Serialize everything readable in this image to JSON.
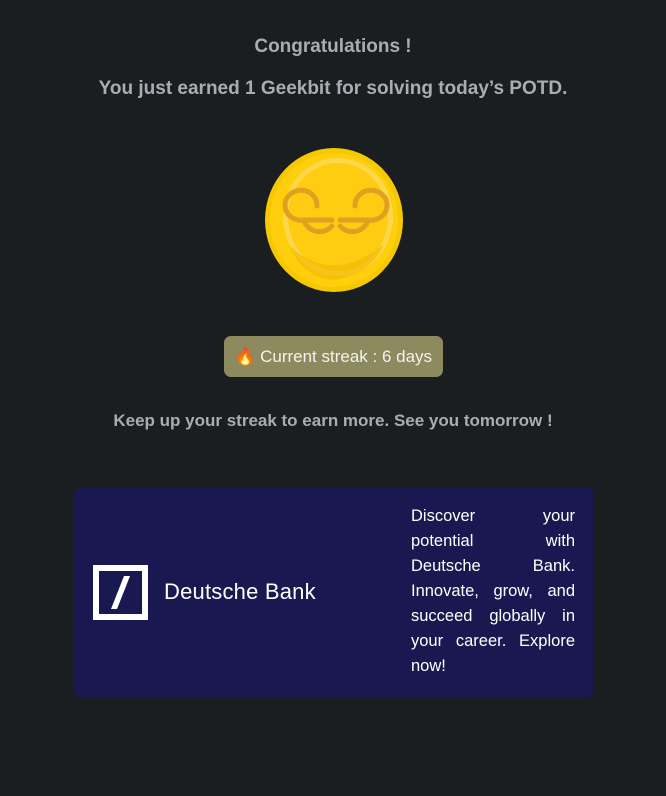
{
  "dialog": {
    "title": "Congratulations !",
    "subtitle": "You just earned 1 Geekbit for solving today’s POTD.",
    "coin": {
      "icon": "geeksforgeeks-coin-icon",
      "colors": {
        "rim": "#f5c800",
        "face": "#ffd21a",
        "emblem": "#e0a020"
      }
    },
    "streak": {
      "icon": "fire-icon",
      "label": "Current streak : 6 days",
      "days": 6,
      "badge_color": "#8d8a60"
    },
    "encouragement": "Keep up your streak to earn more. See you tomorrow !"
  },
  "ad": {
    "brand": "Deutsche Bank",
    "logo_icon": "deutsche-bank-logo-icon",
    "body": "Discover your potential with Deutsche Bank. Innovate, grow, and succeed globally in your career. Explore now!",
    "background_color": "#1a1850"
  },
  "colors": {
    "background": "#1b1e21",
    "muted_text": "#a9adb1"
  }
}
